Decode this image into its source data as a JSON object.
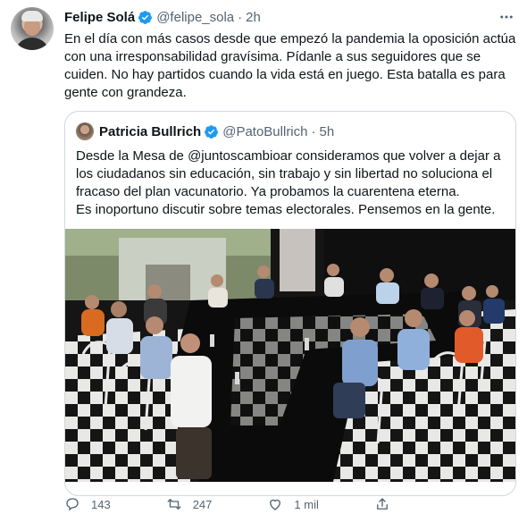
{
  "tweet": {
    "author_name": "Felipe Solá",
    "handle": "@felipe_sola",
    "separator": "·",
    "time": "2h",
    "text": "En el día con más casos desde que empezó la pandemia la oposición actúa con una irresponsabilidad gravísima. Pídanle a sus seguidores que se cuiden. No hay partidos cuando la vida está en juego. Esta batalla es para gente con grandeza."
  },
  "quote": {
    "author_name": "Patricia Bullrich",
    "handle": "@PatoBullrich",
    "separator": "·",
    "time": "5h",
    "lines": [
      "Desde la Mesa de @juntoscambioar consideramos que volver a dejar a",
      "los ciudadanos sin educación, sin trabajo y sin libertad no soluciona el",
      "fracaso del plan vacunatorio. Ya probamos la cuarentena eterna.",
      "Es inoportuno discutir sobre temas electorales. Pensemos en la gente."
    ]
  },
  "actions": {
    "replies": "143",
    "retweets": "247",
    "likes": "1 mil"
  },
  "colors": {
    "verified": "#1d9bf0",
    "secondary_text": "#536471",
    "border": "#cfd9de"
  },
  "icons": [
    "verified-badge-icon",
    "more-options-icon",
    "reply-icon",
    "retweet-icon",
    "like-icon",
    "share-icon"
  ]
}
